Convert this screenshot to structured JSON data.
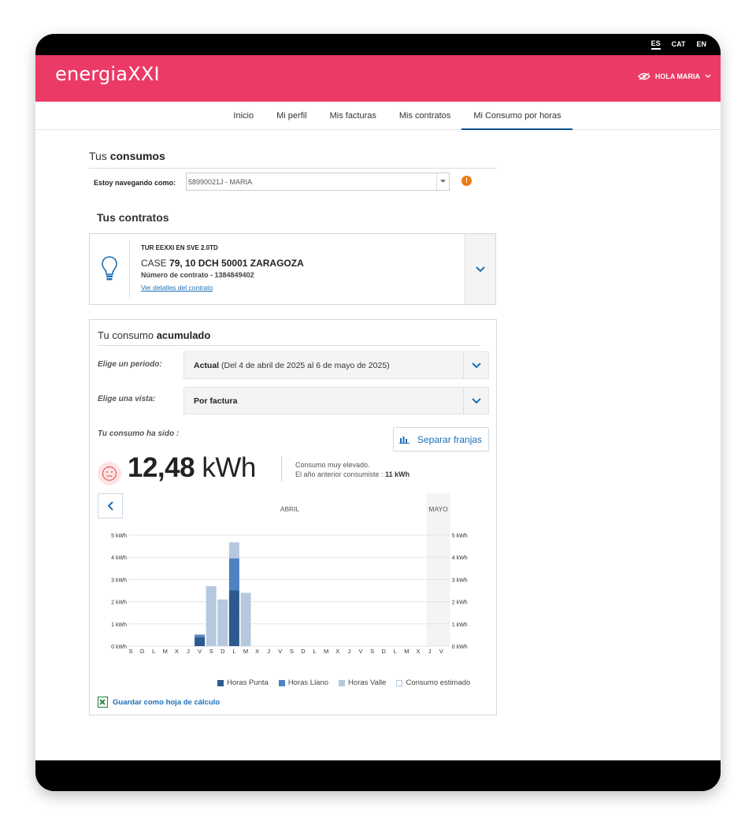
{
  "languages": [
    {
      "code": "ES",
      "active": true
    },
    {
      "code": "CAT",
      "active": false
    },
    {
      "code": "EN",
      "active": false
    }
  ],
  "header": {
    "logo": "energiaXXI",
    "user_greeting": "HOLA MARIA"
  },
  "nav": {
    "items": [
      "Inicio",
      "Mi perfil",
      "Mis facturas",
      "Mis contratos",
      "Mi Consumo por horas"
    ],
    "active": "Mi Consumo por horas"
  },
  "consumos": {
    "title_prefix": "Tus",
    "title_bold": "consumos",
    "navigating_label": "Estoy navegando como:",
    "navigating_value": "58990021J - MARIA"
  },
  "contratos": {
    "title": "Tus contratos",
    "tariff": "TUR EEXXI EN SVE 2.0TD",
    "address_prefix": "CASE",
    "address": "79, 10 DCH 50001 ZARAGOZA",
    "contract_label": "Número de contrato -",
    "contract_number": "1384849402",
    "details_link": "Ver detalles del contrato"
  },
  "acumulado": {
    "title_prefix": "Tu consumo",
    "title_bold": "acumulado",
    "period_label": "Elige un periodo:",
    "period_value_bold": "Actual",
    "period_value_rest": "(Del 4 de abril de 2025 al 6 de mayo de 2025)",
    "view_label": "Elige una vista:",
    "view_value": "Por factura",
    "consumo_label": "Tu consumo ha sido :",
    "separar_button": "Separar franjas",
    "total_value": "12,48",
    "total_unit": "kWh",
    "note_line1": "Consumo muy elevado.",
    "note_line2_prefix": "El año anterior consumiste :",
    "note_line2_value": "11 kWh",
    "save_link": "Guardar como hoja de cálculo"
  },
  "colors": {
    "brand": "#ec3a66",
    "link": "#1a6fb7",
    "punta": "#2d5a8e",
    "llano": "#4f82c4",
    "valle": "#b5c8df",
    "estimado": "#ffffff"
  },
  "chart_data": {
    "type": "bar",
    "stacked": true,
    "months": [
      "ABRIL",
      "MAYO"
    ],
    "categories": [
      "S",
      "D",
      "L",
      "M",
      "X",
      "J",
      "V",
      "S",
      "D",
      "L",
      "M",
      "X",
      "J",
      "V",
      "S",
      "D",
      "L",
      "M",
      "X",
      "J",
      "V",
      "S",
      "D",
      "L",
      "M",
      "X",
      "J",
      "V"
    ],
    "yticks": [
      "0 kWh",
      "1 kWh",
      "2 kWh",
      "3 kWh",
      "4 kWh",
      "5 kWh"
    ],
    "ylim": [
      0,
      5
    ],
    "series": [
      {
        "name": "Horas Punta",
        "values": [
          0,
          0,
          0,
          0,
          0,
          0,
          0.4,
          0,
          0,
          2.5,
          0,
          0,
          0,
          0,
          0,
          0,
          0,
          0,
          0,
          0,
          0,
          0,
          0,
          0,
          0,
          0,
          0,
          0
        ]
      },
      {
        "name": "Horas Llano",
        "values": [
          0,
          0,
          0,
          0,
          0,
          0,
          0.1,
          0,
          0,
          1.45,
          0,
          0,
          0,
          0,
          0,
          0,
          0,
          0,
          0,
          0,
          0,
          0,
          0,
          0,
          0,
          0,
          0,
          0
        ]
      },
      {
        "name": "Horas Valle",
        "values": [
          0,
          0,
          0,
          0,
          0,
          0,
          0.05,
          2.7,
          2.1,
          0.72,
          2.4,
          0,
          0,
          0,
          0,
          0,
          0,
          0,
          0,
          0,
          0,
          0,
          0,
          0,
          0,
          0,
          0,
          0
        ]
      },
      {
        "name": "Consumo estimado",
        "values": [
          0,
          0,
          0,
          0,
          0,
          0,
          0,
          0,
          0,
          0,
          0,
          0,
          0,
          0,
          0,
          0,
          0,
          0,
          0,
          0,
          0,
          0,
          0,
          0,
          0,
          0,
          0,
          0
        ]
      }
    ],
    "mayo_start_index": 26
  }
}
